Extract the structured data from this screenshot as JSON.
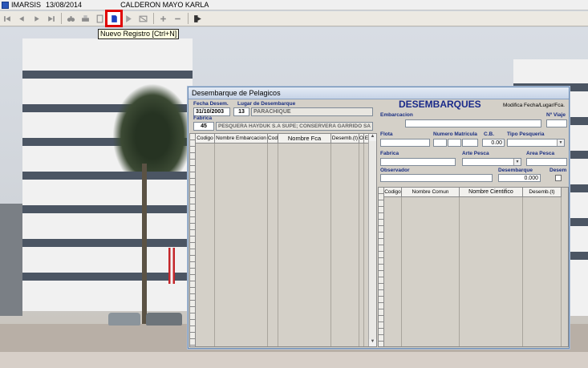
{
  "titlebar": {
    "app": "IMARSIS",
    "date": "13/08/2014",
    "user": "CALDERON MAYO KARLA"
  },
  "toolbar": {
    "buttons": [
      "first-icon",
      "prev-icon",
      "next-icon",
      "last-icon",
      "binoculars-icon",
      "print-icon",
      "copy-icon",
      "new-record-icon",
      "save-icon",
      "edit-icon",
      "add-icon",
      "remove-icon",
      "exit-icon"
    ],
    "tooltip": "Nuevo Registro [Ctrl+N]"
  },
  "window": {
    "title": "Desembarque de Pelagicos",
    "left": {
      "fecha_label": "Fecha Desem.",
      "fecha_value": "31/10/2003",
      "lugar_label": "Lugar de Desembarque",
      "lugar_code": "13",
      "lugar_name": "PARACHIQUE",
      "fabrica_label": "Fabrica",
      "fabrica_code": "45",
      "fabrica_name": "PESQUERA HAYDUK S.A SUPE; CONSERVERA GARRIDO SA ; A",
      "columns": [
        "Codigo",
        "Nombre Embarcacion",
        "Cod",
        "Nombre Fca",
        "Desemb.(t)",
        "O",
        "E"
      ]
    },
    "right": {
      "heading": "DESEMBARQUES",
      "modifica_label": "Modifica Fecha/Lugar/Fca.",
      "embarcacion_label": "Embarcacion",
      "nviaje_label": "Nº Viaje",
      "flota_label": "Flota",
      "matricula_label": "Numero Matricula",
      "cb_label": "C.B.",
      "cb_value": "0.00",
      "tipo_pesqueria_label": "Tipo Pesqueria",
      "fabrica_label": "Fabrica",
      "arte_pesca_label": "Arte Pesca",
      "area_pesca_label": "Area Pesca",
      "observador_label": "Observador",
      "desembarque_label": "Desembarque",
      "desembarque_value": "0.000",
      "desem_label": "Desem",
      "columns": [
        "Codigo",
        "Nombre Comun",
        "Nombre Cientifico",
        "Desemb.(t)"
      ]
    }
  }
}
